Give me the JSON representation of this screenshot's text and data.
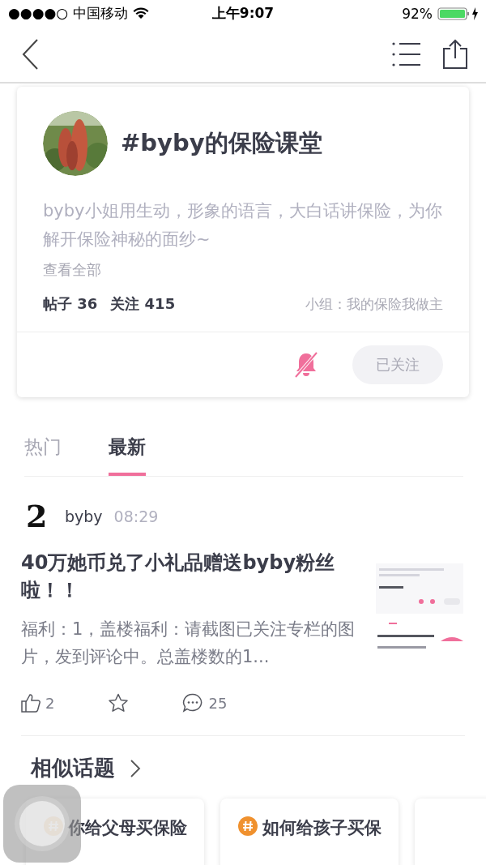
{
  "status_bar": {
    "carrier": "●●●●○ 中国移动",
    "time": "上午9:07",
    "battery": "92%"
  },
  "topic": {
    "title": "#byby的保险课堂",
    "description": "byby小姐用生动，形象的语言，大白话讲保险，为你解开保险神秘的面纱~",
    "more": "查看全部",
    "posts": "帖子 36",
    "followers": "关注 415",
    "group": "小组：我的保险我做主",
    "follow_button": "已关注"
  },
  "tabs": [
    {
      "label": "热门",
      "selected": false
    },
    {
      "label": "最新",
      "selected": true
    }
  ],
  "post": {
    "avatar": "2",
    "author": "byby",
    "time": "08:29",
    "title": "40万她币兑了小礼品赠送byby粉丝啦！！",
    "excerpt": "福利：1，盖楼福利：请截图已关注专栏的图片，发到评论中。总盖楼数的1...",
    "likes": "2",
    "comments": "25"
  },
  "similar": {
    "heading": "相似话题",
    "topics": [
      {
        "title": "你给父母买保险"
      },
      {
        "title": "如何给孩子买保"
      }
    ]
  }
}
